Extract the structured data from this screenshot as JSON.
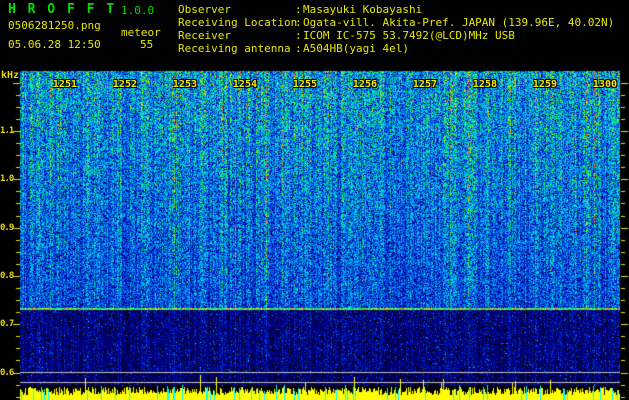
{
  "colors": {
    "background": "#000000",
    "title_green": "#00dd00",
    "text_yellow": "#e8e800",
    "axis_yellow": "#f0e000",
    "time_label_yellow": "#ffe800",
    "gray_line": "#c0c0c0"
  },
  "app": {
    "title": "H R O F F T",
    "version": "1.0.0",
    "filename": "0506281250.png",
    "mode": "meteor",
    "datetime": "05.06.28 12:50",
    "count": "55"
  },
  "station": {
    "separator": ":",
    "rows": [
      {
        "label": "Observer",
        "value": "Masayuki Kobayashi"
      },
      {
        "label": "Receiving Location",
        "value": "Ogata-vill. Akita-Pref. JAPAN (139.96E, 40.02N)"
      },
      {
        "label": "Receiver",
        "value": "ICOM IC-575 53.7492(@LCD)MHz USB"
      },
      {
        "label": "Receiving antenna",
        "value": "A504HB(yagi 4el)"
      }
    ]
  },
  "chart_data": {
    "type": "heatmap",
    "subtype": "radio-meteor-spectrogram",
    "ylabel": "kHz",
    "y_tick_labels": [
      "1.1",
      "1.0",
      "0.9",
      "0.8",
      "0.7",
      "0.6"
    ],
    "y_tick_values": [
      1.1,
      1.0,
      0.9,
      0.8,
      0.7,
      0.6
    ],
    "y_minor_step_khz": 0.025,
    "y_range_khz": [
      0.55,
      1.22
    ],
    "x_tick_labels": [
      "1251",
      "1252",
      "1253",
      "1254",
      "1255",
      "1256",
      "1257",
      "1258",
      "1259",
      "1300"
    ],
    "x_start_time": "12:50",
    "x_end_time": "13:00",
    "x_minutes_per_div": 1,
    "grid": false,
    "legend": "none",
    "features": {
      "carrier_line_khz": 0.73,
      "carrier_line_desc": "continuous bright multicolored horizontal echo line across full width",
      "gray_lines_khz": [
        0.602,
        0.58
      ],
      "noise_desc": "dense blue/cyan/green speckle noise, brightest near top, with vertical meteor-echo streak columns",
      "dark_band_desc": "much darker sparse noise below the carrier line"
    },
    "signal_bar_graph": {
      "position": "bottom edge",
      "bar_color": "#ffff00",
      "event_color": "#00ffff",
      "description": "per-second signal-strength bars; cyan columns mark meteor echo events"
    },
    "palette": [
      "#000018",
      "#00008c",
      "#0028c8",
      "#0064f0",
      "#00a0f0",
      "#00dcdc",
      "#00e682",
      "#3cf03c",
      "#b4f000",
      "#ffdc00",
      "#ff7800",
      "#ff2828"
    ]
  }
}
